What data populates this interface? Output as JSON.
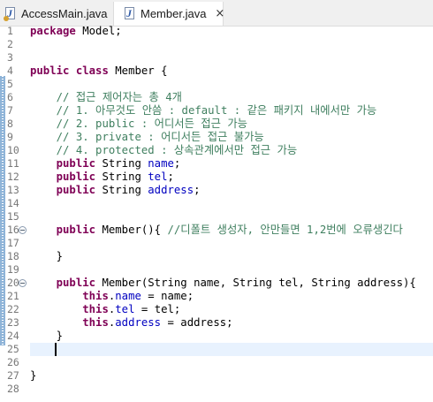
{
  "tabs": [
    {
      "label": "AccessMain.java",
      "icon": "java-file-icon",
      "active": false
    },
    {
      "label": "Member.java",
      "icon": "java-file-icon",
      "active": true,
      "close": "×"
    }
  ],
  "editor": {
    "lines": [
      {
        "n": "1",
        "tokens": [
          {
            "t": "package",
            "c": "kw"
          },
          {
            "t": " Model;"
          }
        ]
      },
      {
        "n": "2",
        "tokens": []
      },
      {
        "n": "3",
        "tokens": []
      },
      {
        "n": "4",
        "tokens": [
          {
            "t": "public",
            "c": "kw"
          },
          {
            "t": " "
          },
          {
            "t": "class",
            "c": "kw"
          },
          {
            "t": " Member {"
          }
        ]
      },
      {
        "n": "5",
        "tokens": []
      },
      {
        "n": "6",
        "tokens": [
          {
            "t": "    "
          },
          {
            "t": "// 접근 제어자는 총 4개",
            "c": "cm"
          }
        ]
      },
      {
        "n": "7",
        "tokens": [
          {
            "t": "    "
          },
          {
            "t": "// 1. 아무것도 안씀 : default : 같은 패키지 내에서만 가능",
            "c": "cm"
          }
        ]
      },
      {
        "n": "8",
        "tokens": [
          {
            "t": "    "
          },
          {
            "t": "// 2. public : 어디서든 접근 가능",
            "c": "cm"
          }
        ]
      },
      {
        "n": "9",
        "tokens": [
          {
            "t": "    "
          },
          {
            "t": "// 3. private : 어디서든 접근 불가능",
            "c": "cm"
          }
        ]
      },
      {
        "n": "10",
        "tokens": [
          {
            "t": "    "
          },
          {
            "t": "// 4. protected : 상속관계에서만 접근 가능",
            "c": "cm"
          }
        ]
      },
      {
        "n": "11",
        "tokens": [
          {
            "t": "    "
          },
          {
            "t": "public",
            "c": "kw"
          },
          {
            "t": " String "
          },
          {
            "t": "name",
            "c": "fd"
          },
          {
            "t": ";"
          }
        ]
      },
      {
        "n": "12",
        "tokens": [
          {
            "t": "    "
          },
          {
            "t": "public",
            "c": "kw"
          },
          {
            "t": " String "
          },
          {
            "t": "tel",
            "c": "fd"
          },
          {
            "t": ";"
          }
        ]
      },
      {
        "n": "13",
        "tokens": [
          {
            "t": "    "
          },
          {
            "t": "public",
            "c": "kw"
          },
          {
            "t": " String "
          },
          {
            "t": "address",
            "c": "fd"
          },
          {
            "t": ";"
          }
        ]
      },
      {
        "n": "14",
        "tokens": []
      },
      {
        "n": "15",
        "tokens": []
      },
      {
        "n": "16",
        "fold": true,
        "tokens": [
          {
            "t": "    "
          },
          {
            "t": "public",
            "c": "kw"
          },
          {
            "t": " Member(){ "
          },
          {
            "t": "//디폴트 생성자, 안만들면 1,2번에 오류생긴다",
            "c": "cm"
          }
        ]
      },
      {
        "n": "17",
        "tokens": []
      },
      {
        "n": "18",
        "tokens": [
          {
            "t": "    }"
          }
        ]
      },
      {
        "n": "19",
        "tokens": []
      },
      {
        "n": "20",
        "fold": true,
        "tokens": [
          {
            "t": "    "
          },
          {
            "t": "public",
            "c": "kw"
          },
          {
            "t": " Member(String name, String tel, String address){"
          }
        ]
      },
      {
        "n": "21",
        "tokens": [
          {
            "t": "        "
          },
          {
            "t": "this",
            "c": "kw"
          },
          {
            "t": "."
          },
          {
            "t": "name",
            "c": "fd"
          },
          {
            "t": " = name;"
          }
        ]
      },
      {
        "n": "22",
        "tokens": [
          {
            "t": "        "
          },
          {
            "t": "this",
            "c": "kw"
          },
          {
            "t": "."
          },
          {
            "t": "tel",
            "c": "fd"
          },
          {
            "t": " = tel;"
          }
        ]
      },
      {
        "n": "23",
        "tokens": [
          {
            "t": "        "
          },
          {
            "t": "this",
            "c": "kw"
          },
          {
            "t": "."
          },
          {
            "t": "address",
            "c": "fd"
          },
          {
            "t": " = address;"
          }
        ]
      },
      {
        "n": "24",
        "tokens": [
          {
            "t": "    }"
          }
        ]
      },
      {
        "n": "25",
        "tokens": []
      },
      {
        "n": "26",
        "tokens": []
      },
      {
        "n": "27",
        "tokens": [
          {
            "t": "}"
          }
        ]
      },
      {
        "n": "28",
        "tokens": []
      }
    ],
    "current_line": "25"
  }
}
